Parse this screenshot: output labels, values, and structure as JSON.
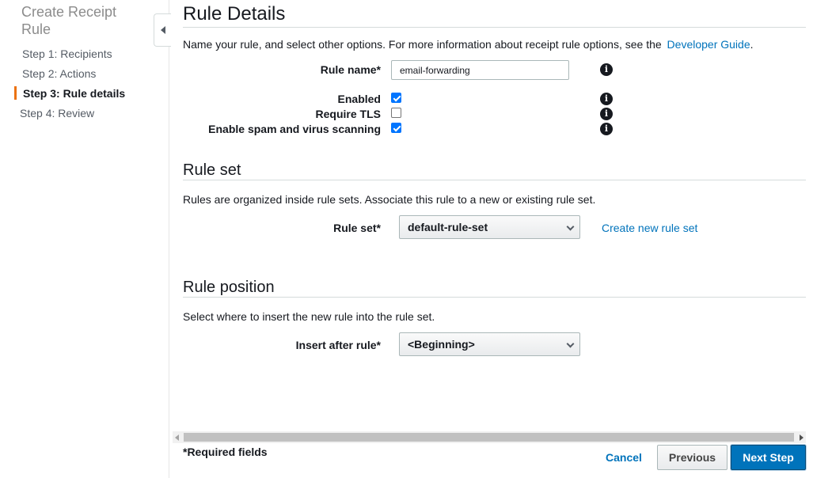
{
  "sidebar": {
    "title": "Create Receipt Rule",
    "steps": [
      {
        "label": "Step 1: Recipients",
        "active": false
      },
      {
        "label": "Step 2: Actions",
        "active": false
      },
      {
        "label": "Step 3: Rule details",
        "active": true
      },
      {
        "label": "Step 4: Review",
        "active": false
      }
    ],
    "accent_color": "#ec7211"
  },
  "rule_details": {
    "heading": "Rule Details",
    "description": "Name your rule, and select other options. For more information about receipt rule options, see the",
    "guide_link": "Developer Guide",
    "trailing_period": ".",
    "rule_name_label": "Rule name*",
    "rule_name_value": "email-forwarding",
    "enabled_label": "Enabled",
    "enabled_checked": true,
    "tls_label": "Require TLS",
    "tls_checked": false,
    "spam_label": "Enable spam and virus scanning",
    "spam_checked": true,
    "info_glyph": "i"
  },
  "rule_set": {
    "heading": "Rule set",
    "description": "Rules are organized inside rule sets. Associate this rule to a new or existing rule set.",
    "label": "Rule set*",
    "selected": "default-rule-set",
    "create_link": "Create new rule set"
  },
  "rule_position": {
    "heading": "Rule position",
    "description": "Select where to insert the new rule into the rule set.",
    "label": "Insert after rule*",
    "selected": "<Beginning>"
  },
  "footer": {
    "required_note": "*Required fields",
    "cancel_label": "Cancel",
    "previous_label": "Previous",
    "next_label": "Next Step"
  },
  "colors": {
    "link": "#0073bb",
    "primary_button": "#0073bb",
    "checkbox": "#0075ff"
  }
}
